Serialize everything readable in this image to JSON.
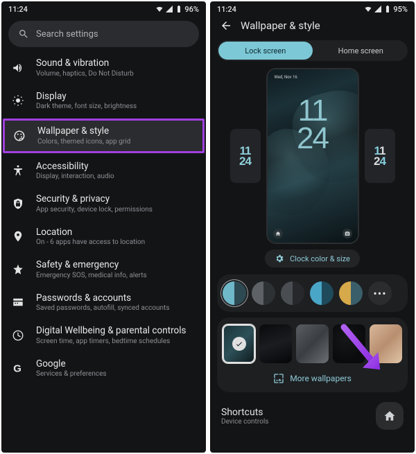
{
  "left": {
    "status": {
      "time": "11:24",
      "battery": "96%"
    },
    "search_placeholder": "Search settings",
    "items": [
      {
        "icon": "sound",
        "title": "Sound & vibration",
        "sub": "Volume, haptics, Do Not Disturb"
      },
      {
        "icon": "display",
        "title": "Display",
        "sub": "Dark theme, font size, brightness"
      },
      {
        "icon": "wallpaper",
        "title": "Wallpaper & style",
        "sub": "Colors, themed icons, app grid",
        "highlight": true
      },
      {
        "icon": "accessibility",
        "title": "Accessibility",
        "sub": "Display, interaction, audio"
      },
      {
        "icon": "security",
        "title": "Security & privacy",
        "sub": "App security, device lock, permissions"
      },
      {
        "icon": "location",
        "title": "Location",
        "sub": "On - 6 apps have access to location"
      },
      {
        "icon": "safety",
        "title": "Safety & emergency",
        "sub": "Emergency SOS, medical info, alerts"
      },
      {
        "icon": "passwords",
        "title": "Passwords & accounts",
        "sub": "Saved passwords, autofill, synced accounts"
      },
      {
        "icon": "wellbeing",
        "title": "Digital Wellbeing & parental controls",
        "sub": "Screen time, app timers, bedtime schedules"
      },
      {
        "icon": "google",
        "title": "Google",
        "sub": "Services & preferences"
      }
    ]
  },
  "right": {
    "status": {
      "time": "11:24",
      "battery": "95%"
    },
    "title": "Wallpaper & style",
    "tabs": {
      "lock": "Lock screen",
      "home": "Home screen"
    },
    "preview": {
      "date": "Wed, Nov 16",
      "clock_h": "11",
      "clock_m": "24"
    },
    "side_clocks": {
      "left_line1": "11",
      "left_line2": "24",
      "right_line1": "11",
      "right_line2": "24"
    },
    "chip_label": "Clock color & size",
    "swatches": [
      {
        "c1": "#6fb8c9",
        "c2": "#2d4a52",
        "selected": true
      },
      {
        "c1": "#5e6266",
        "c2": "#2e3134"
      },
      {
        "c1": "#4a4e52",
        "c2": "#26282b"
      },
      {
        "c1": "#4aa6c7",
        "c2": "#1e4a5c"
      },
      {
        "c1": "#d6a94a",
        "c2": "#3a5f6b"
      }
    ],
    "more_wallpapers": "More wallpapers",
    "shortcuts": {
      "title": "Shortcuts",
      "sub": "Device controls"
    }
  }
}
